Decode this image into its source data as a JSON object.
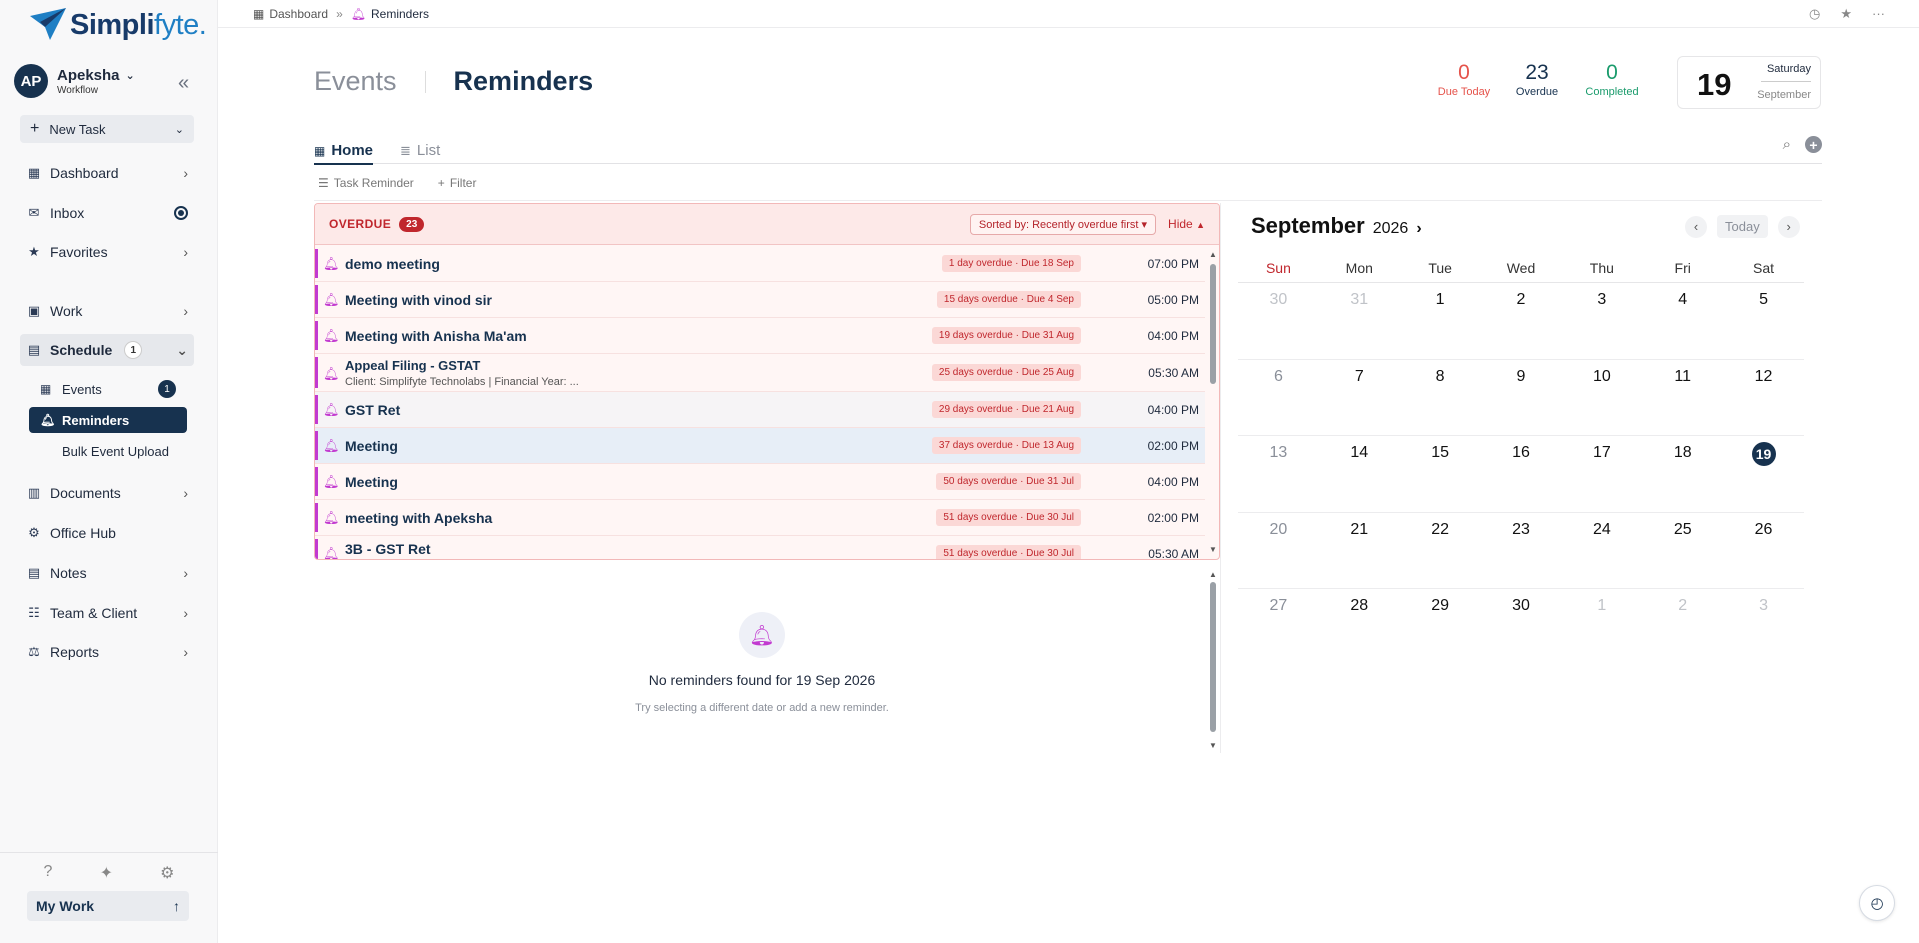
{
  "brand": {
    "name_a": "Simpli",
    "name_b": "fyte."
  },
  "user": {
    "initials": "AP",
    "name": "Apeksha",
    "sub": "Workflow"
  },
  "sidebar": {
    "new_task": "New Task",
    "items": [
      {
        "label": "Dashboard"
      },
      {
        "label": "Inbox"
      },
      {
        "label": "Favorites"
      },
      {
        "label": "Work"
      },
      {
        "label": "Schedule",
        "badge": "1"
      },
      {
        "label": "Documents"
      },
      {
        "label": "Office Hub"
      },
      {
        "label": "Notes"
      },
      {
        "label": "Team & Client"
      },
      {
        "label": "Reports"
      }
    ],
    "schedule_sub": [
      {
        "label": "Events",
        "badge": "1"
      },
      {
        "label": "Reminders"
      },
      {
        "label": "Bulk Event Upload"
      }
    ],
    "my_work": "My Work"
  },
  "breadcrumb": [
    "Dashboard",
    "Reminders"
  ],
  "header": {
    "tab_events": "Events",
    "tab_reminders": "Reminders"
  },
  "stats": [
    {
      "value": "0",
      "label": "Due Today",
      "color": "#e5534b"
    },
    {
      "value": "23",
      "label": "Overdue",
      "color": "#17324f"
    },
    {
      "value": "0",
      "label": "Completed",
      "color": "#1a9b6c"
    }
  ],
  "date_card": {
    "day": "19",
    "weekday": "Saturday",
    "month": "September"
  },
  "view_tabs": {
    "home": "Home",
    "list": "List"
  },
  "toolbar": {
    "task_reminder": "Task Reminder",
    "filter": "Filter"
  },
  "overdue": {
    "title": "OVERDUE",
    "count": "23",
    "sort": "Sorted by: Recently overdue first",
    "hide": "Hide",
    "rows": [
      {
        "title": "demo meeting",
        "due": "1 day overdue · Due 18 Sep",
        "time": "07:00 PM"
      },
      {
        "title": "Meeting with vinod sir",
        "due": "15 days overdue · Due 4 Sep",
        "time": "05:00 PM"
      },
      {
        "title": "Meeting with Anisha Ma'am",
        "due": "19 days overdue · Due 31 Aug",
        "time": "04:00 PM"
      },
      {
        "title": "Appeal Filing - GSTAT",
        "sub": "Client: Simplifyte Technolabs | Financial Year: ...",
        "due": "25 days overdue · Due 25 Aug",
        "time": "05:30 AM"
      },
      {
        "title": "GST Ret",
        "due": "29 days overdue · Due 21 Aug",
        "time": "04:00 PM"
      },
      {
        "title": "Meeting",
        "due": "37 days overdue · Due 13 Aug",
        "time": "02:00 PM"
      },
      {
        "title": "Meeting",
        "due": "50 days overdue · Due 31 Jul",
        "time": "04:00 PM"
      },
      {
        "title": "meeting with Apeksha",
        "due": "51 days overdue · Due 30 Jul",
        "time": "02:00 PM"
      },
      {
        "title": "3B - GST Ret",
        "due": "51 days overdue · Due 30 Jul",
        "time": "05:30 AM"
      }
    ]
  },
  "empty": {
    "title": "No reminders found for 19 Sep 2026",
    "sub": "Try selecting a different date or add a new reminder."
  },
  "calendar": {
    "month": "September",
    "year": "2026",
    "today_label": "Today",
    "dow": [
      "Sun",
      "Mon",
      "Tue",
      "Wed",
      "Thu",
      "Fri",
      "Sat"
    ],
    "weeks": [
      [
        "30",
        "31",
        "1",
        "2",
        "3",
        "4",
        "5"
      ],
      [
        "6",
        "7",
        "8",
        "9",
        "10",
        "11",
        "12"
      ],
      [
        "13",
        "14",
        "15",
        "16",
        "17",
        "18",
        "19"
      ],
      [
        "20",
        "21",
        "22",
        "23",
        "24",
        "25",
        "26"
      ],
      [
        "27",
        "28",
        "29",
        "30",
        "1",
        "2",
        "3"
      ]
    ],
    "selected": "19"
  }
}
